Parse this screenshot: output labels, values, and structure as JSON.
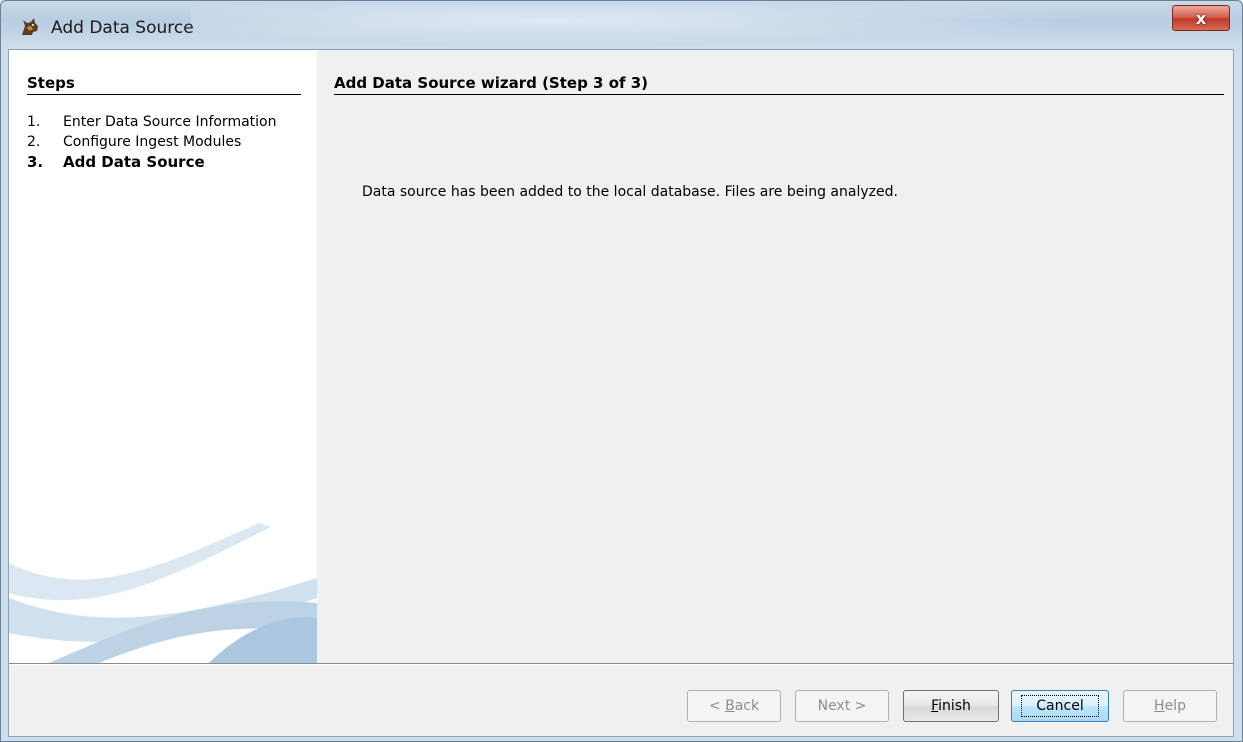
{
  "window": {
    "title": "Add Data Source",
    "close_label": "x"
  },
  "steps": {
    "title": "Steps",
    "items": [
      {
        "num": "1.",
        "label": "Enter Data Source Information",
        "current": false
      },
      {
        "num": "2.",
        "label": "Configure Ingest Modules",
        "current": false
      },
      {
        "num": "3.",
        "label": "Add Data Source",
        "current": true
      }
    ]
  },
  "main": {
    "title": "Add Data Source wizard (Step 3 of 3)",
    "message": "Data source has been added to the local database. Files are being analyzed."
  },
  "buttons": {
    "back": {
      "label": "< Back",
      "mnemonic": "B",
      "enabled": false
    },
    "next": {
      "label": "Next >",
      "enabled": false
    },
    "finish": {
      "label": "Finish",
      "mnemonic": "F",
      "enabled": true
    },
    "cancel": {
      "label": "Cancel",
      "enabled": true,
      "focused": true
    },
    "help": {
      "label": "Help",
      "mnemonic": "H",
      "enabled": false
    }
  },
  "icons": {
    "app": "autopsy-dog-icon",
    "close": "close-icon"
  }
}
